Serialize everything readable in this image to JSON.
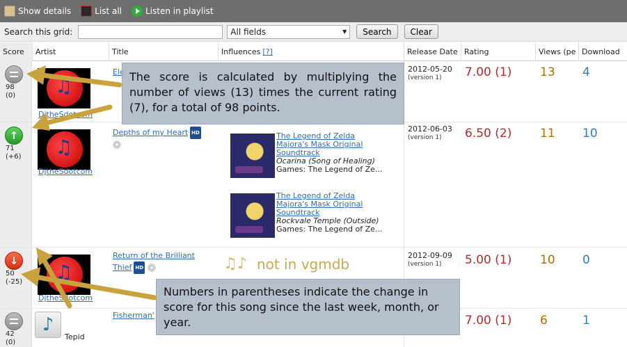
{
  "toolbar": {
    "show_details": "Show details",
    "list_all": "List all",
    "listen_playlist": "Listen in playlist"
  },
  "search": {
    "label": "Search this grid:",
    "value": "",
    "placeholder": "",
    "field_select": "All fields",
    "search_button": "Search",
    "clear_button": "Clear"
  },
  "columns": {
    "score": "Score",
    "artist": "Artist",
    "title": "Title",
    "influences": "Influences",
    "influences_help": "[?]",
    "release_date": "Release Date",
    "rating": "Rating",
    "views": "Views (pe",
    "download": "Download"
  },
  "rows": [
    {
      "score": "98",
      "change": "(0)",
      "trend": "equal",
      "artist": "DjtheSdotcom",
      "title": "Ele",
      "release": "2012-05-20",
      "version": "(version 1)",
      "rating": "7.00 (1)",
      "views": "13",
      "downloads": "4"
    },
    {
      "score": "71",
      "change": "(+6)",
      "trend": "up",
      "artist": "DjtheSdotcom",
      "title": "Depths of my Heart",
      "hd": "HD",
      "release": "2012-06-03",
      "version": "(version 1)",
      "rating": "6.50 (2)",
      "views": "11",
      "downloads": "10",
      "influences": [
        {
          "album_line1": "The Legend of Zelda",
          "album_line2": "Majora's Mask Original",
          "album_line3": "Soundtrack",
          "track": "Ocarina (Song of Healing)",
          "games": "Games: The Legend of Ze..."
        },
        {
          "album_line1": "The Legend of Zelda",
          "album_line2": "Majora's Mask Original",
          "album_line3": "Soundtrack",
          "track": "Rockvale Temple (Outside)",
          "games": "Games: The Legend of Ze..."
        }
      ]
    },
    {
      "score": "50",
      "change": "(-25)",
      "trend": "down",
      "artist": "DjtheSdotcom",
      "title_line1": "Return of the Brilliant",
      "title_line2": "Thief",
      "hd": "HD",
      "not_in_vgmdb": "not in vgmdb",
      "release": "2012-09-09",
      "version": "(version 1)",
      "rating": "5.00 (1)",
      "views": "10",
      "downloads": "0"
    },
    {
      "score": "42",
      "change": "(0)",
      "trend": "equal",
      "artist": "Tepid",
      "title": "Fisherman'",
      "rating": "7.00 (1)",
      "views": "6",
      "downloads": "1"
    }
  ],
  "callouts": {
    "score_explanation": "The score is calculated by multiplying the number of views (13) times the current rating (7), for a total of 98 points.",
    "parentheses_explanation": "Numbers in parentheses indicate the change in score for this song since the last week, month, or year."
  },
  "colors": {
    "toolbar_bg": "#6f6f6f",
    "rating": "#b22a2a",
    "views": "#b06d00",
    "downloads": "#2e7bbf",
    "link": "#2e6ab1",
    "arrow": "#c8a23c"
  }
}
